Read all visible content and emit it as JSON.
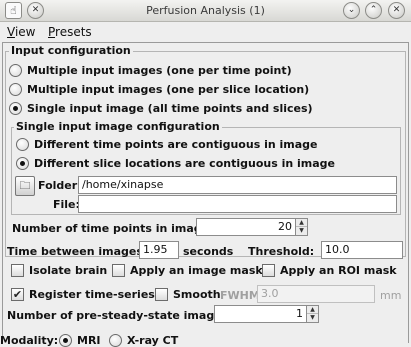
{
  "window": {
    "title": "Perfusion Analysis (1)",
    "app_icon": "imagej-icon",
    "controls": [
      "chevron-down-icon",
      "chevron-up-icon",
      "close-icon"
    ]
  },
  "menubar": {
    "items": [
      "View",
      "Presets"
    ]
  },
  "input_config": {
    "title": "Input configuration",
    "options": [
      "Multiple input images (one per time point)",
      "Multiple input images (one per slice location)",
      "Single input image (all time points and slices)"
    ],
    "selected": 2
  },
  "single_config": {
    "title": "Single input image configuration",
    "options": [
      "Different time points are contiguous in image",
      "Different slice locations are contiguous in image"
    ],
    "selected": 1,
    "folder_label": "Folder:",
    "folder_value": "/home/xinapse",
    "file_label": "File:",
    "file_value": ""
  },
  "timepoints": {
    "label": "Number of time points in image:",
    "value": "20"
  },
  "timing": {
    "between_label": "Time between images:",
    "between_value": "1.95",
    "units": "seconds",
    "threshold_label": "Threshold:",
    "threshold_value": "10.0"
  },
  "options": {
    "isolate_brain": {
      "label": "Isolate brain",
      "checked": false
    },
    "image_mask": {
      "label": "Apply an image mask",
      "checked": false
    },
    "roi_mask": {
      "label": "Apply an ROI mask",
      "checked": false
    },
    "register": {
      "label": "Register time-series",
      "checked": true
    },
    "smooth": {
      "label": "Smooth",
      "checked": false
    }
  },
  "smoothing": {
    "fwhm_label": "FWHM",
    "fwhm_value": "3.0",
    "units": "mm"
  },
  "pre_steady": {
    "label": "Number of pre-steady-state images:",
    "value": "1"
  },
  "modality": {
    "label": "Modality:",
    "options": [
      "MRI",
      "X-ray CT"
    ],
    "selected": 0
  }
}
